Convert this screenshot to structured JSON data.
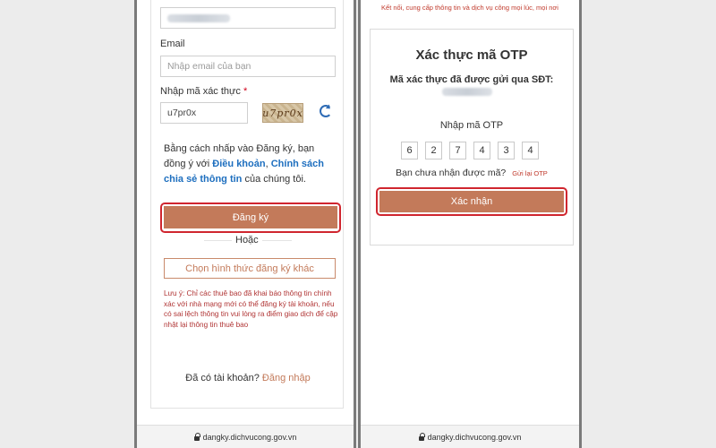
{
  "signup": {
    "email_label": "Email",
    "email_placeholder": "Nhập email của bạn",
    "captcha_label": "Nhập mã xác thực",
    "captcha_required_mark": "*",
    "captcha_value": "u7pr0x",
    "captcha_image_text": "u7pr0x",
    "terms_prefix": "Bằng cách nhấp vào Đăng ký, bạn đồng ý với ",
    "terms_link": "Điều khoản",
    "terms_sep": ", ",
    "privacy_link": "Chính sách chia sẻ thông tin",
    "terms_suffix": " của chúng tôi.",
    "register_button": "Đăng ký",
    "or_text": "Hoặc",
    "alt_button": "Chọn hình thức đăng ký khác",
    "note": "Lưu ý: Chỉ các thuê bao đã khai báo thông tin chính xác với nhà mạng mới có thể đăng ký tài khoản, nếu có sai lệch thông tin vui lòng ra điểm giao dịch để cập nhật lại thông tin thuê bao",
    "have_account": "Đã có tài khoản?",
    "login_link": "Đăng nhập",
    "url": "dangky.dichvucong.gov.vn"
  },
  "otp": {
    "tagline": "Kết nối, cung cấp thông tin và dịch vụ công mọi lúc, mọi nơi",
    "title": "Xác thực mã OTP",
    "subtitle": "Mã xác thực đã được gửi qua SĐT:",
    "input_label": "Nhập mã OTP",
    "digits": [
      "6",
      "2",
      "7",
      "4",
      "3",
      "4"
    ],
    "not_received": "Bạn chưa nhận được mã?",
    "resend_link": "Gửi lại OTP",
    "confirm_button": "Xác nhận",
    "url": "dangky.dichvucong.gov.vn"
  },
  "colors": {
    "accent": "#c37a5a",
    "highlight": "#d0262f",
    "link": "#1e6fbf",
    "note": "#b03434"
  }
}
